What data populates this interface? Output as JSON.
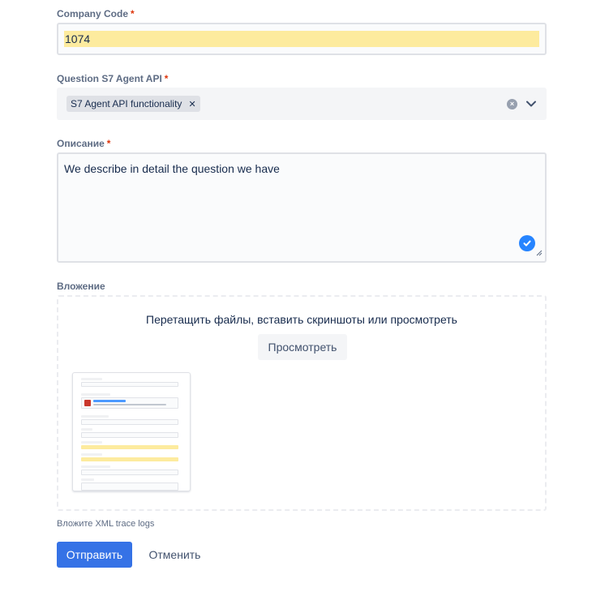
{
  "colors": {
    "accent": "#3572e6",
    "required": "#de350b",
    "highlight": "#fdeb9e",
    "success_check": "#2684ff"
  },
  "company_code": {
    "label": "Company Code",
    "required_mark": "*",
    "value": "1074"
  },
  "question": {
    "label": "Question S7 Agent API",
    "required_mark": "*",
    "selected_tag": "S7 Agent API functionality",
    "tag_remove_glyph": "✕",
    "clear_glyph": "×",
    "icons": [
      "clear-icon",
      "chevron-down-icon"
    ]
  },
  "description": {
    "label": "Описание",
    "required_mark": "*",
    "value": "We describe in detail the question we have",
    "icons": [
      "check-circle-icon",
      "resize-handle-icon"
    ]
  },
  "attachment": {
    "label": "Вложение",
    "drop_text": "Перетащить файлы, вставить скриншоты или просмотреть",
    "browse_button": "Просмотреть",
    "thumbnail_icon": "attachment-thumbnail",
    "helper_text": "Вложите XML trace logs"
  },
  "actions": {
    "submit_label": "Отправить",
    "cancel_label": "Отменить"
  }
}
